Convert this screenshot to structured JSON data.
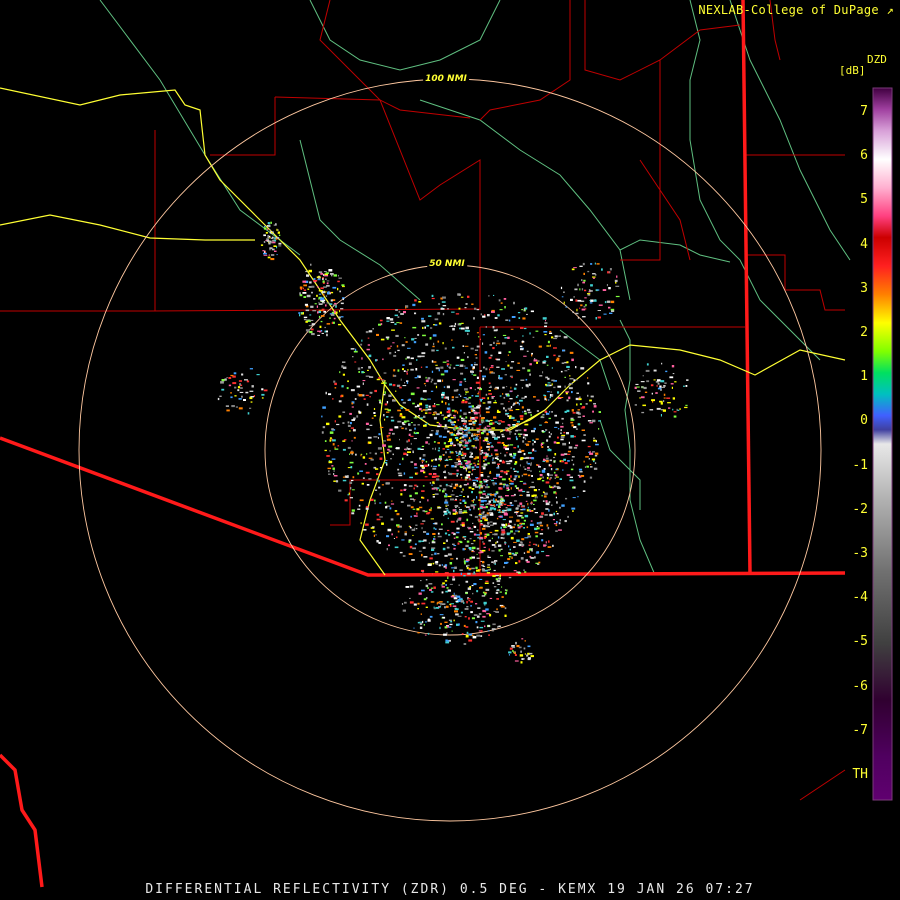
{
  "header": {
    "credit": "NEXLAB-College of DuPage"
  },
  "footer": {
    "product_line": "DIFFERENTIAL REFLECTIVITY (ZDR) 0.5 DEG - KEMX 19 JAN 26 07:27"
  },
  "range_rings": {
    "inner_label": "50 NMI",
    "outer_label": "100 NMI"
  },
  "legend": {
    "code": "DZD",
    "unit": "[dB]",
    "ticks": [
      "7",
      "6",
      "5",
      "4",
      "3",
      "2",
      "1",
      "0",
      "-1",
      "-2",
      "-3",
      "-4",
      "-5",
      "-6",
      "-7",
      "TH"
    ]
  },
  "colors": {
    "state_borders": "#cc0000",
    "international_border": "#ff2020",
    "highways": "#ffff33",
    "rivers": "#66cc88",
    "range_rings": "#ffc8a0",
    "text": "#ffff33"
  },
  "icons": {
    "external_link": "external-link-icon"
  }
}
